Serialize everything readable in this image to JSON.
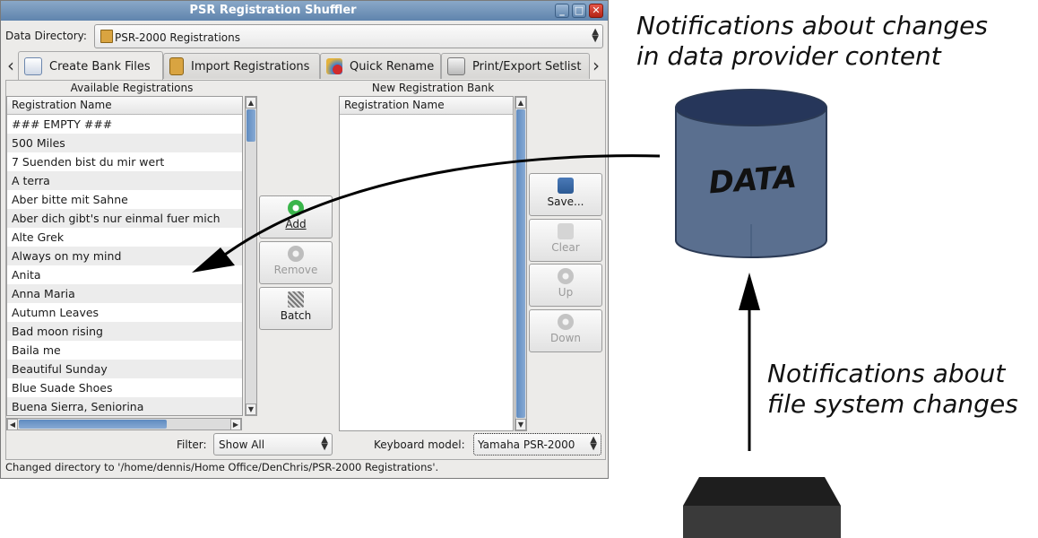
{
  "window": {
    "title": "PSR Registration Shuffler",
    "controls": [
      "_",
      "□",
      "✕"
    ]
  },
  "data_directory": {
    "label": "Data Directory:",
    "value": "PSR-2000 Registrations"
  },
  "tabs": [
    {
      "label": "Create Bank Files",
      "icon": "create-bank-icon"
    },
    {
      "label": "Import Registrations",
      "icon": "import-icon"
    },
    {
      "label": "Quick Rename",
      "icon": "quick-rename-icon"
    },
    {
      "label": "Print/Export Setlist",
      "icon": "printer-icon"
    }
  ],
  "available": {
    "section_label": "Available Registrations",
    "column_header": "Registration Name",
    "items": [
      "### EMPTY ###",
      "500 Miles",
      "7 Suenden bist du mir wert",
      "A terra",
      "Aber bitte mit Sahne",
      "Aber dich gibt's nur einmal fuer mich",
      "Alte Grek",
      "Always on my mind",
      "Anita",
      "Anna Maria",
      "Autumn Leaves",
      "Bad moon rising",
      "Baila me",
      "Beautiful Sunday",
      "Blue Suade Shoes",
      "Buena Sierra, Seniorina"
    ]
  },
  "new_bank": {
    "section_label": "New Registration Bank",
    "column_header": "Registration Name"
  },
  "middle_buttons": {
    "add": "Add",
    "remove": "Remove",
    "batch": "Batch"
  },
  "right_buttons": {
    "save": "Save...",
    "clear": "Clear",
    "up": "Up",
    "down": "Down"
  },
  "filter": {
    "label": "Filter:",
    "value": "Show All"
  },
  "keyboard": {
    "label": "Keyboard model:",
    "value": "Yamaha PSR-2000"
  },
  "status": "Changed directory to '/home/dennis/Home Office/DenChris/PSR-2000 Registrations'.",
  "annotations": {
    "data_provider": [
      "Notifications about changes",
      "in data provider content"
    ],
    "file_system": [
      "Notifications about",
      "file system changes"
    ],
    "database_label": "DATA"
  },
  "colors": {
    "titlebar": "#6f91b8",
    "cylinder_body": "#5a6f8f",
    "cylinder_top": "#26365a",
    "box_dark": "#222222",
    "selection_thumb": "#6a93c6",
    "add_green": "#39b54a"
  }
}
